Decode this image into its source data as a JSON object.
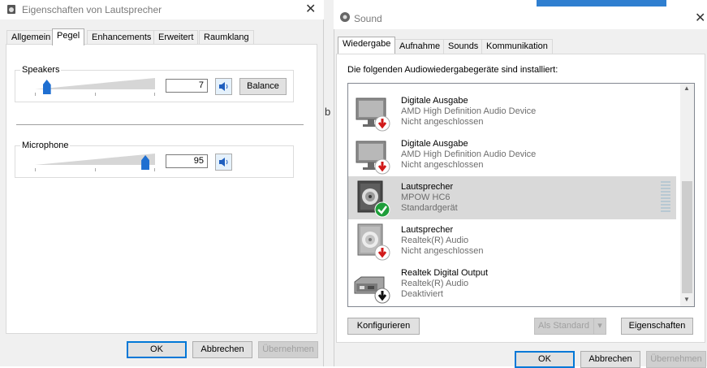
{
  "left_dialog": {
    "title": "Eigenschaften von Lautsprecher",
    "close_glyph": "✕",
    "tabs": [
      "Allgemein",
      "Pegel",
      "Enhancements",
      "Erweitert",
      "Raumklang"
    ],
    "selected_tab": "Pegel",
    "speakers": {
      "label": "Speakers",
      "value": "7",
      "level_fraction": 0.07,
      "balance_label": "Balance"
    },
    "microphone": {
      "label": "Microphone",
      "value": "95",
      "level_fraction": 0.95
    },
    "buttons": {
      "ok": "OK",
      "cancel": "Abbrechen",
      "apply": "Übernehmen"
    }
  },
  "right_dialog": {
    "title": "Sound",
    "close_glyph": "✕",
    "tabs": [
      "Wiedergabe",
      "Aufnahme",
      "Sounds",
      "Kommunikation"
    ],
    "selected_tab": "Wiedergabe",
    "instruction": "Die folgenden Audiowiedergabegeräte sind installiert:",
    "devices": [
      {
        "name": "Digitale Ausgabe",
        "driver": "AMD High Definition Audio Device",
        "status": "Nicht angeschlossen",
        "icon": "monitor-icon",
        "badge": "red-down-arrow"
      },
      {
        "name": "Digitale Ausgabe",
        "driver": "AMD High Definition Audio Device",
        "status": "Nicht angeschlossen",
        "icon": "monitor-icon",
        "badge": "red-down-arrow"
      },
      {
        "name": "Lautsprecher",
        "driver": "MPOW HC6",
        "status": "Standardgerät",
        "icon": "speaker-icon",
        "badge": "green-check"
      },
      {
        "name": "Lautsprecher",
        "driver": "Realtek(R) Audio",
        "status": "Nicht angeschlossen",
        "icon": "speaker-icon",
        "badge": "red-down-arrow"
      },
      {
        "name": "Realtek Digital Output",
        "driver": "Realtek(R) Audio",
        "status": "Deaktiviert",
        "icon": "digital-output-icon",
        "badge": "black-down-arrow"
      }
    ],
    "scroll_up": "▲",
    "scroll_down": "▼",
    "buttons": {
      "configure": "Konfigurieren",
      "set_default": "Als Standard",
      "properties": "Eigenschaften",
      "ok": "OK",
      "cancel": "Abbrechen",
      "apply": "Übernehmen"
    }
  },
  "background": {
    "partial_char": "b"
  },
  "colors": {
    "accent": "#0078d7",
    "thumb": "#1f6fd1",
    "selected_row": "#d9d9d9",
    "badge_red": "#d11a1a",
    "badge_green": "#1e9e3a"
  }
}
